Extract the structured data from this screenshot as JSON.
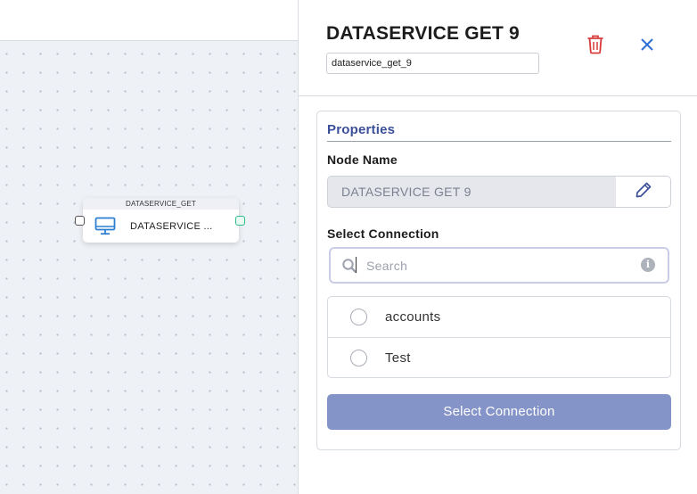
{
  "canvas": {
    "node": {
      "type_label": "DATASERVICE_GET",
      "name_truncated": "DATASERVICE ...",
      "icon": "monitor-icon"
    }
  },
  "panel": {
    "title": "DATASERVICE GET 9",
    "node_id": "dataservice_get_9",
    "delete_icon": "trash-icon",
    "close_icon": "close-icon",
    "properties": {
      "heading": "Properties",
      "node_name_label": "Node Name",
      "node_name_value": "DATASERVICE GET 9",
      "edit_icon": "pencil-icon",
      "select_connection_label": "Select Connection",
      "search_placeholder": "Search",
      "connections": [
        {
          "label": "accounts",
          "selected": false
        },
        {
          "label": "Test",
          "selected": false
        }
      ],
      "select_button_label": "Select Connection"
    }
  },
  "colors": {
    "accent": "#3c4f99",
    "button_bg": "#8594c8",
    "delete_red": "#d63b3b",
    "close_blue": "#2f6fd6",
    "output_port": "#2dbd8d"
  }
}
